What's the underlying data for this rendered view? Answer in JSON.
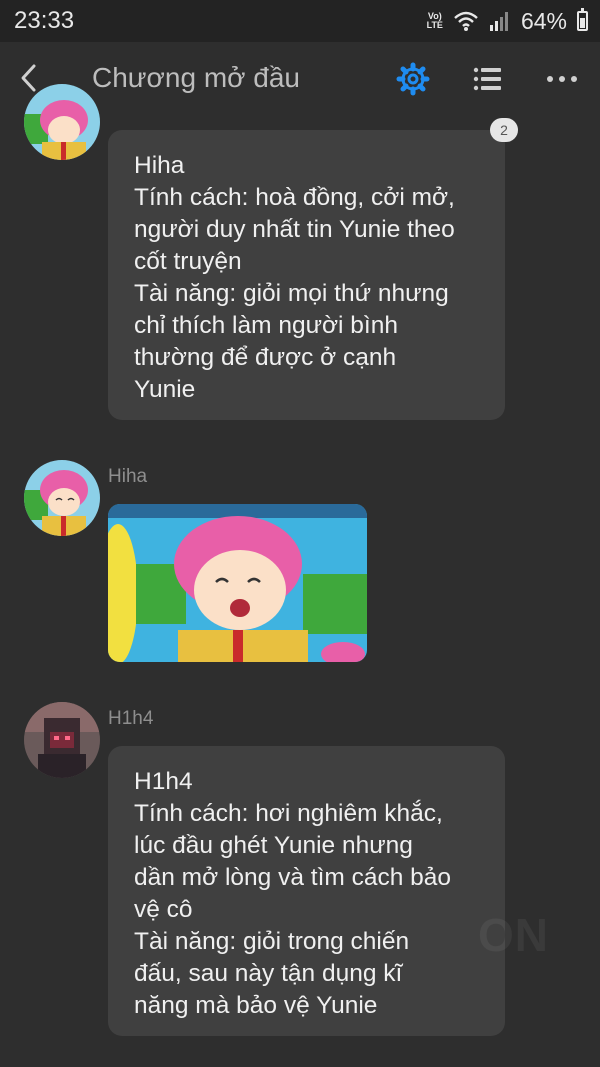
{
  "status_bar": {
    "time": "23:33",
    "network_label_top": "Vo)",
    "network_label_bottom": "LTE",
    "battery": "64%",
    "battery_level": 0.64
  },
  "header": {
    "title": "Chương mở đầu",
    "accent_color": "#1f8cf0"
  },
  "messages": [
    {
      "sender": "",
      "read_count": "2",
      "lines": [
        "Hiha",
        "Tính cách: hoà đồng, cởi mở,",
        "người duy nhất tin Yunie theo",
        "cốt truyện",
        "Tài năng: giỏi mọi thứ nhưng",
        "chỉ thích làm người bình",
        "thường để được ở cạnh",
        "Yunie"
      ]
    },
    {
      "sender": "Hiha",
      "type": "image"
    },
    {
      "sender": "H1h4",
      "lines": [
        "H1h4",
        "Tính cách: hơi nghiêm khắc,",
        "lúc đầu ghét Yunie nhưng",
        "dần mở lòng và tìm cách bảo",
        "vệ cô",
        "Tài năng: giỏi trong chiến",
        "đấu, sau này tận dụng kĩ",
        "năng mà bảo vệ Yunie"
      ]
    }
  ],
  "watermark": "ON"
}
